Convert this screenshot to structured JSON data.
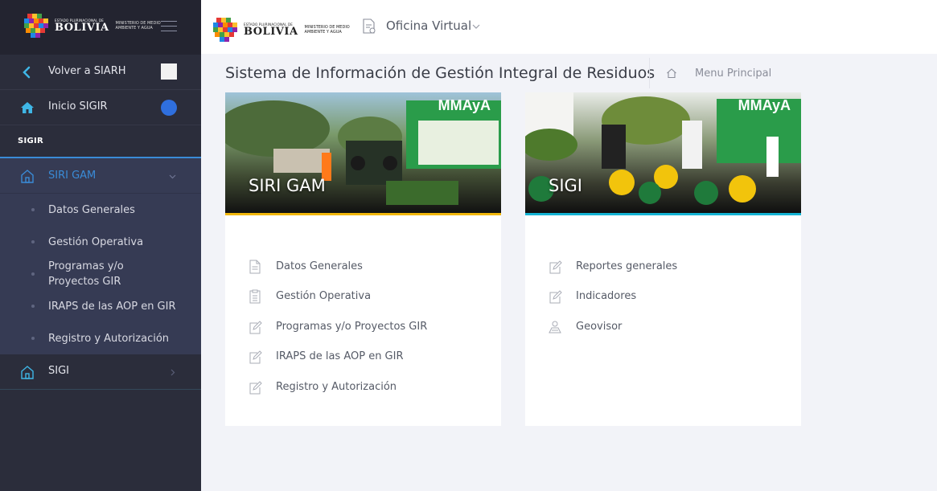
{
  "brand": {
    "estado": "ESTADO PLURINACIONAL DE",
    "country": "BOLIVIA",
    "ministry": "MINISTERIO DE MEDIO AMBIENTE Y AGUA"
  },
  "topbar": {
    "app_label": "Oficina Virtual"
  },
  "sidebar": {
    "back_label": "Volver a SIARH",
    "home_label": "Inicio SIGIR",
    "section": "SIGIR",
    "active_menu": "SIRI GAM",
    "submenu": [
      "Datos Generales",
      "Gestión Operativa",
      "Programas y/o Proyectos GIR",
      "IRAPS de las AOP en GIR",
      "Registro y Autorización"
    ],
    "other_menu": "SIGI"
  },
  "page": {
    "title": "Sistema de Información de Gestión Integral de Residuos",
    "breadcrumb": "Menu Principal"
  },
  "cards": [
    {
      "title": "SIRI GAM",
      "banner_brand": "MMAyA",
      "accent": "#f2b70b",
      "links": [
        {
          "label": "Datos Generales",
          "icon": "document-icon"
        },
        {
          "label": "Gestión Operativa",
          "icon": "checklist-icon"
        },
        {
          "label": "Programas y/o Proyectos GIR",
          "icon": "edit-form-icon"
        },
        {
          "label": "IRAPS de las AOP en GIR",
          "icon": "edit-form-icon"
        },
        {
          "label": "Registro y Autorización",
          "icon": "edit-form-icon"
        }
      ]
    },
    {
      "title": "SIGI",
      "banner_brand": "MMAyA",
      "accent": "#14b3d3",
      "links": [
        {
          "label": "Reportes generales",
          "icon": "edit-form-icon"
        },
        {
          "label": "Indicadores",
          "icon": "edit-form-icon"
        },
        {
          "label": "Geovisor",
          "icon": "map-user-icon"
        }
      ]
    }
  ],
  "colors": {
    "sidebar_bg": "#2b2d3b",
    "active_blue": "#3a8bd6",
    "page_bg": "#f2f3f8"
  }
}
